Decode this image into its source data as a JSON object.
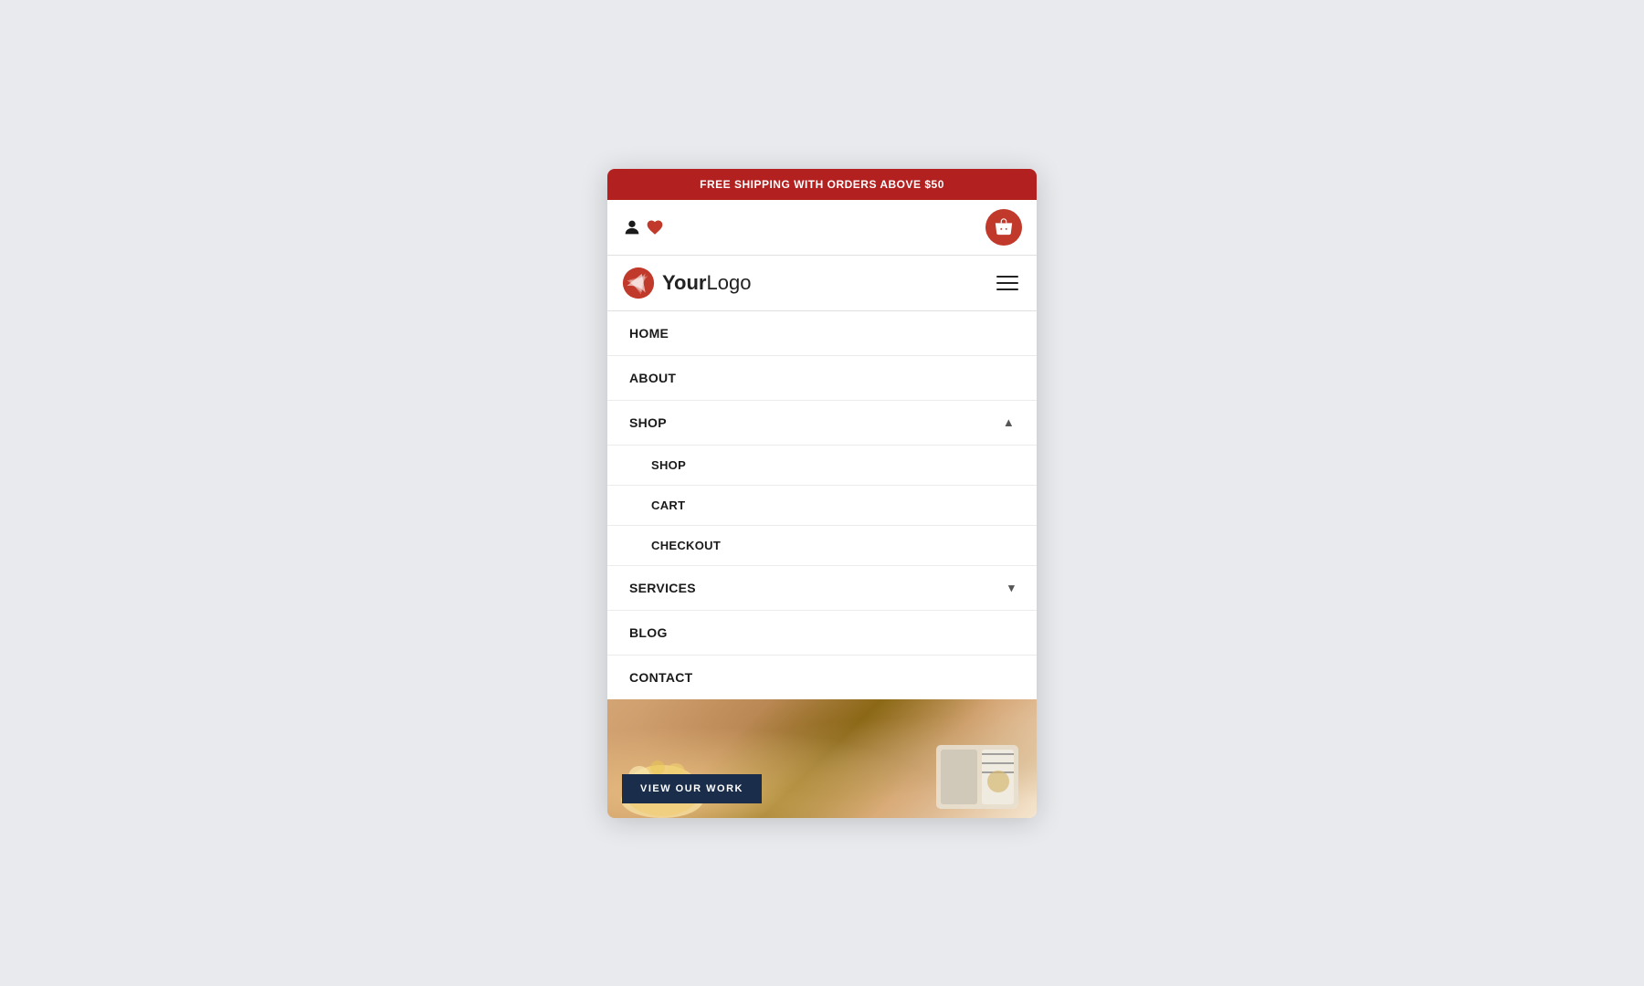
{
  "promo_banner": {
    "text": "FREE SHIPPING WITH ORDERS ABOVE $50"
  },
  "header": {
    "logo_text_bold": "Your",
    "logo_text_regular": "Logo",
    "hamburger_label": "Menu"
  },
  "nav": {
    "items": [
      {
        "id": "home",
        "label": "HOME",
        "has_children": false
      },
      {
        "id": "about",
        "label": "ABOUT",
        "has_children": false
      },
      {
        "id": "shop",
        "label": "SHOP",
        "has_children": true,
        "expanded": true,
        "chevron": "▲",
        "children": [
          {
            "id": "shop-sub",
            "label": "SHOP"
          },
          {
            "id": "cart",
            "label": "CART"
          },
          {
            "id": "checkout",
            "label": "CHECKOUT"
          }
        ]
      },
      {
        "id": "services",
        "label": "SERVICES",
        "has_children": true,
        "expanded": false,
        "chevron": "▾"
      },
      {
        "id": "blog",
        "label": "BLOG",
        "has_children": false
      },
      {
        "id": "contact",
        "label": "CONTACT",
        "has_children": false
      }
    ]
  },
  "hero": {
    "view_work_btn": "VIEW OUR WORK"
  },
  "colors": {
    "promo_bg": "#b22020",
    "cart_circle": "#c0392b",
    "nav_bg": "#ffffff",
    "hero_dark_btn": "#1a2d4a"
  }
}
